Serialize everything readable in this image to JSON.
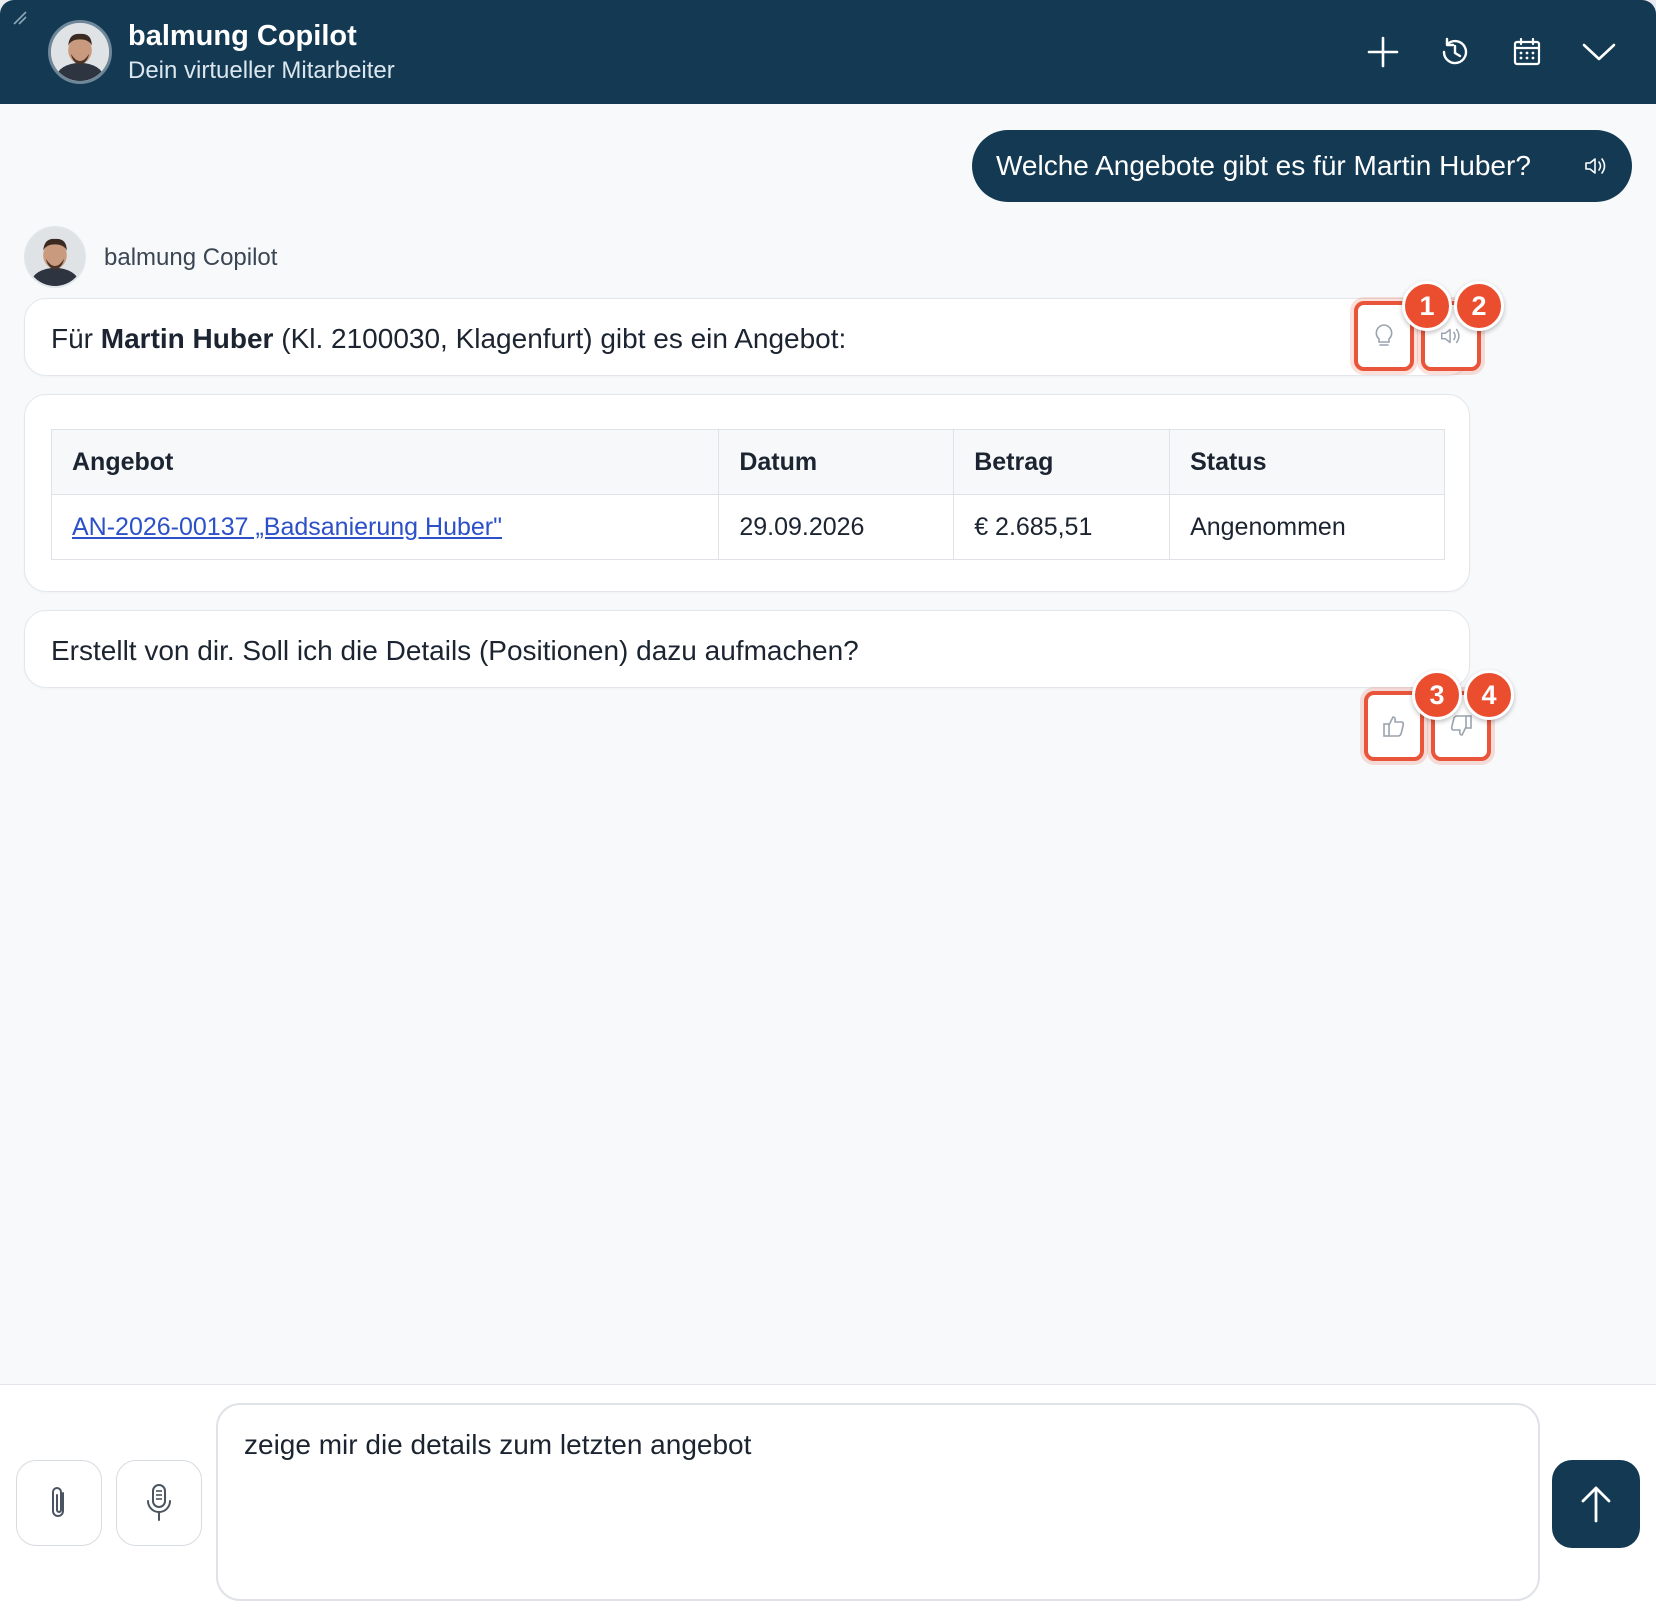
{
  "header": {
    "title": "balmung Copilot",
    "subtitle": "Dein virtueller Mitarbeiter",
    "icons": [
      "plus-icon",
      "history-icon",
      "calendar-icon",
      "chevron-down-icon"
    ]
  },
  "chat": {
    "user_message": "Welche Angebote gibt es für Martin Huber?",
    "bot_name": "balmung Copilot",
    "bot_message_1": {
      "prefix": "Für ",
      "bold": "Martin Huber",
      "suffix": " (Kl. 2100030, Klagenfurt) gibt es ein Angebot:"
    },
    "table": {
      "headers": [
        "Angebot",
        "Datum",
        "Betrag",
        "Status"
      ],
      "rows": [
        {
          "angebot": "AN-2026-00137 „Badsanierung Huber\"",
          "datum": "29.09.2026",
          "betrag": "€ 2.685,51",
          "status": "Angenommen"
        }
      ]
    },
    "bot_message_2": "Erstellt von dir. Soll ich die Details (Positionen) dazu aufmachen?",
    "annotations": [
      "1",
      "2",
      "3",
      "4"
    ]
  },
  "composer": {
    "value": "zeige mir die details zum letzten angebot"
  },
  "colors": {
    "brand": "#143a53",
    "annotation": "#ea4e2f",
    "link": "#2b50c8"
  }
}
